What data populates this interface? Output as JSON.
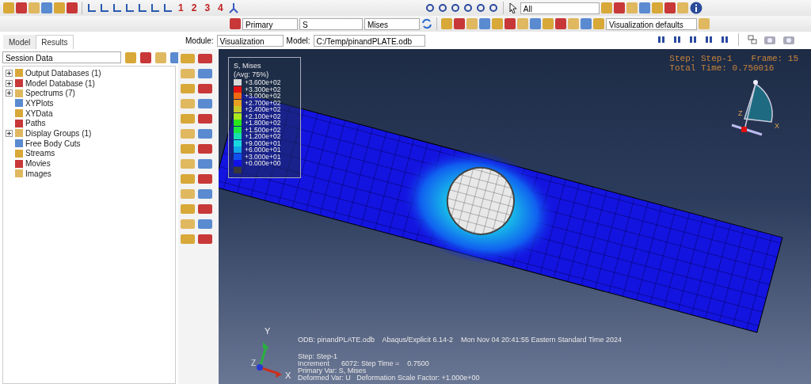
{
  "toolbar": {
    "view_numbers": [
      "1",
      "2",
      "3",
      "4"
    ],
    "selection_filter": "All"
  },
  "results_toolbar": {
    "step_option": "Primary",
    "variable": "S",
    "invariant": "Mises",
    "style_option": "Visualization defaults"
  },
  "context_bar": {
    "module_label": "Module:",
    "module": "Visualization",
    "model_label": "Model:",
    "model": "C:/Temp/pinandPLATE.odb"
  },
  "tabs": [
    {
      "label": "Model",
      "selected": false
    },
    {
      "label": "Results",
      "selected": true
    }
  ],
  "tree": {
    "filter": "Session Data",
    "items": [
      {
        "label": "Output Databases (1)",
        "expandable": true
      },
      {
        "label": "Model Database (1)",
        "expandable": true
      },
      {
        "label": "Spectrums (7)",
        "expandable": true
      },
      {
        "label": "XYPlots",
        "expandable": false
      },
      {
        "label": "XYData",
        "expandable": false
      },
      {
        "label": "Paths",
        "expandable": false
      },
      {
        "label": "Display Groups (1)",
        "expandable": true
      },
      {
        "label": "Free Body Cuts",
        "expandable": false
      },
      {
        "label": "Streams",
        "expandable": false
      },
      {
        "label": "Movies",
        "expandable": false
      },
      {
        "label": "Images",
        "expandable": false
      }
    ]
  },
  "legend": {
    "title": "S, Mises",
    "subtitle": "(Avg: 75%)",
    "levels": [
      {
        "value": "+3.600e+02",
        "color": "#d8d8d8"
      },
      {
        "value": "+3.300e+02",
        "color": "#e51414"
      },
      {
        "value": "+3.000e+02",
        "color": "#ee6a10"
      },
      {
        "value": "+2.700e+02",
        "color": "#e8a020"
      },
      {
        "value": "+2.400e+02",
        "color": "#c8c828"
      },
      {
        "value": "+2.100e+02",
        "color": "#a8e81c"
      },
      {
        "value": "+1.800e+02",
        "color": "#28e818"
      },
      {
        "value": "+1.500e+02",
        "color": "#18e840"
      },
      {
        "value": "+1.200e+02",
        "color": "#18e0b0"
      },
      {
        "value": "+9.000e+01",
        "color": "#18d8e0"
      },
      {
        "value": "+6.000e+01",
        "color": "#10a8e8"
      },
      {
        "value": "+3.000e+01",
        "color": "#1050f0"
      },
      {
        "value": "+0.000e+00",
        "color": "#1010e8"
      },
      {
        "color": "#383838"
      }
    ]
  },
  "state_block": {
    "step": "Step: Step-1",
    "frame": "Frame: 15",
    "total_time": "Total Time: 0.750016"
  },
  "orientation": {
    "z_label": "Z",
    "x_label": "X"
  },
  "triad": {
    "y_label": "Y",
    "z_label": "Z",
    "x_label": "X"
  },
  "title_block": "ODB: pinandPLATE.odb    Abaqus/Explicit 6.14-2    Mon Nov 04 20:41:55 Eastern Standard Time 2024",
  "info_lines": [
    "Step: Step-1",
    "Increment      6072: Step Time =    0.7500",
    "Primary Var: S, Mises",
    "Deformed Var: U   Deformation Scale Factor: +1.000e+00"
  ]
}
